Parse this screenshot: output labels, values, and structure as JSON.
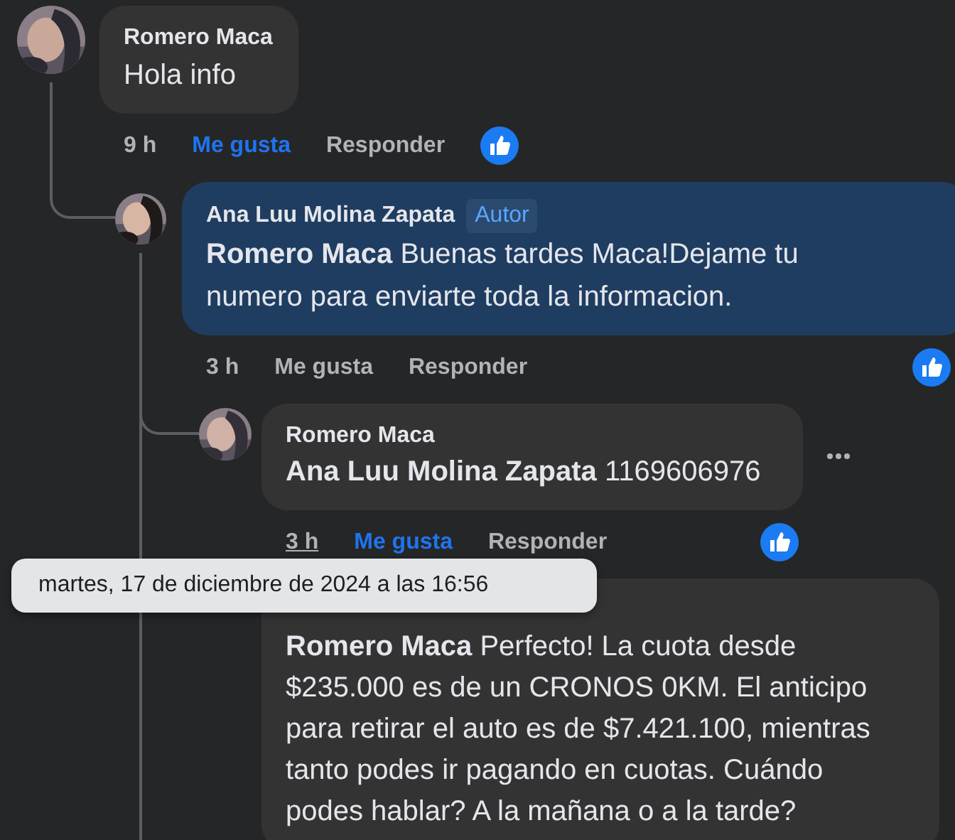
{
  "comments": [
    {
      "author": "Romero Maca",
      "text": "Hola info",
      "time": "9 h",
      "like_label": "Me gusta",
      "reply_label": "Responder",
      "liked": true,
      "reaction": true,
      "highlighted": false,
      "hovered": false,
      "children": [
        {
          "author": "Ana Luu Molina Zapata",
          "badge": "Autor",
          "mention": "Romero Maca",
          "text": "Buenas tardes Maca!Dejame tu numero para enviarte toda la informacion.",
          "time": "3 h",
          "like_label": "Me gusta",
          "reply_label": "Responder",
          "liked": false,
          "reaction": true,
          "highlighted": true,
          "hovered": false,
          "children": [
            {
              "author": "Romero Maca",
              "mention": "Ana Luu Molina Zapata",
              "text": "1169606976",
              "time": "3 h",
              "like_label": "Me gusta",
              "reply_label": "Responder",
              "liked": true,
              "reaction": true,
              "highlighted": false,
              "hovered": true
            },
            {
              "mention": "Romero Maca",
              "text": "Perfecto! La cuota desde $235.000 es de un CRONOS 0KM. El anticipo para retirar el auto es de $7.421.100, mientras tanto podes ir pagando en cuotas. Cuándo podes hablar? A la mañana o a la tarde?",
              "highlighted": false
            }
          ]
        }
      ]
    }
  ],
  "tooltip": {
    "text": "martes, 17 de diciembre de 2024 a las 16:56"
  }
}
